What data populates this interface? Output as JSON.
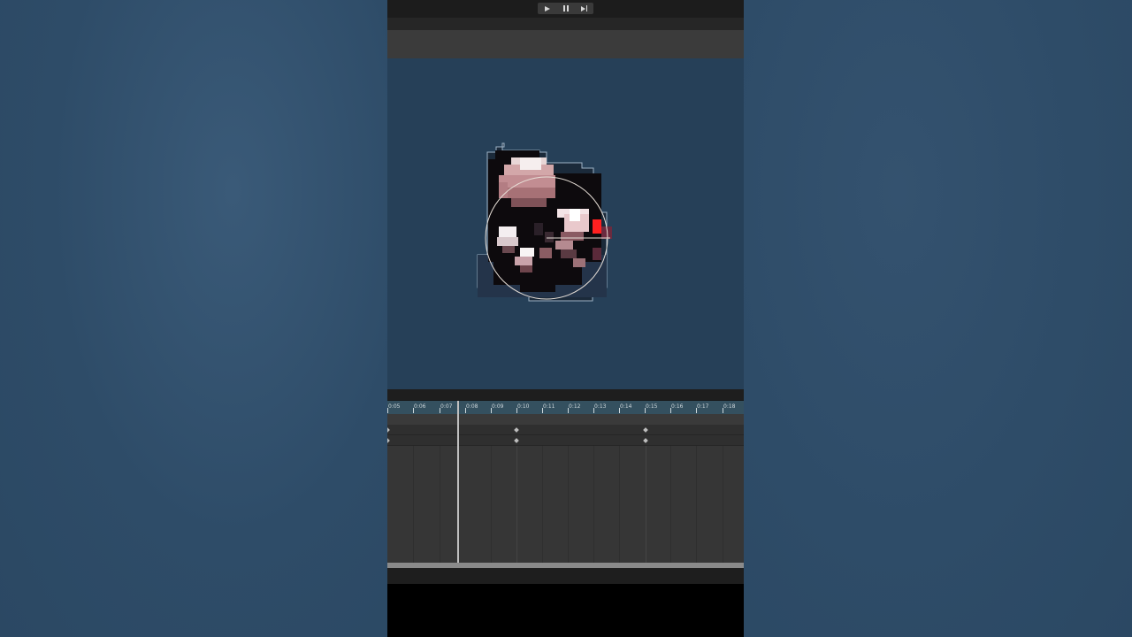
{
  "transport": {
    "play_icon": "play-icon",
    "pause_icon": "pause-icon",
    "step_icon": "step-forward-icon"
  },
  "timeline": {
    "ruler_labels": [
      "0:05",
      "0:06",
      "0:07",
      "0:08",
      "0:09",
      "0:10",
      "0:11",
      "0:12",
      "0:13",
      "0:14",
      "0:15",
      "0:16",
      "0:17",
      "0:18"
    ],
    "track_count": 2
  },
  "colors": {
    "viewport_bg": "#264058",
    "outer_bg": "#2f4d6a",
    "sprite_outline": "#000000",
    "sprite_highlight": "#ff2020"
  }
}
